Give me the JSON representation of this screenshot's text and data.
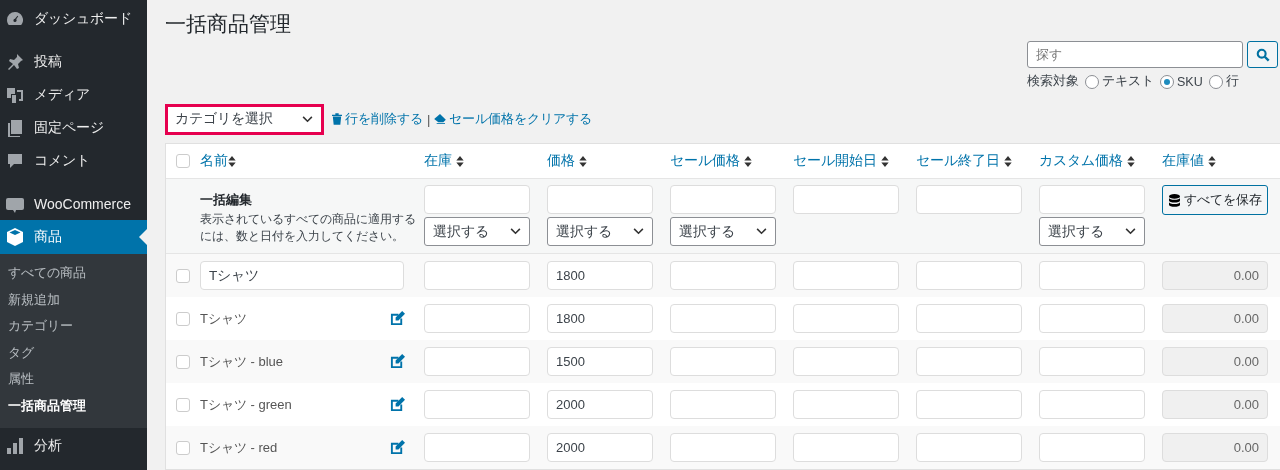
{
  "sidebar": {
    "groups": [
      [
        {
          "label": "ダッシュボード",
          "selected": false
        }
      ],
      [
        {
          "label": "投稿",
          "selected": false
        },
        {
          "label": "メディア",
          "selected": false
        },
        {
          "label": "固定ページ",
          "selected": false
        },
        {
          "label": "コメント",
          "selected": false
        }
      ],
      [
        {
          "label": "WooCommerce",
          "selected": false
        },
        {
          "label": "商品",
          "selected": true,
          "children": [
            {
              "label": "すべての商品",
              "selected": false
            },
            {
              "label": "新規追加",
              "selected": false
            },
            {
              "label": "カテゴリー",
              "selected": false
            },
            {
              "label": "タグ",
              "selected": false
            },
            {
              "label": "属性",
              "selected": false
            },
            {
              "label": "一括商品管理",
              "selected": true
            }
          ]
        },
        {
          "label": "分析",
          "selected": false
        }
      ]
    ]
  },
  "page_title": "一括商品管理",
  "search": {
    "placeholder": "探す",
    "target_label": "検索対象",
    "targets": [
      {
        "label": "テキスト",
        "selected": false
      },
      {
        "label": "SKU",
        "selected": true
      },
      {
        "label": "行",
        "selected": false
      }
    ]
  },
  "category_select": {
    "value": "カテゴリを選択"
  },
  "actions": [
    {
      "label": "行を削除する"
    },
    {
      "label": "セール価格をクリアする"
    }
  ],
  "action_separator": "|",
  "table": {
    "columns": [
      "名前",
      "在庫",
      "価格",
      "セール価格",
      "セール開始日",
      "セール終了日",
      "カスタム価格",
      "在庫値"
    ],
    "header_checked": false,
    "bulk": {
      "title": "一括編集",
      "description": "表示されているすべての商品に適用するには、数と日付を入力してください。",
      "fields": [
        {
          "kind": "input_select",
          "select": "選択する"
        },
        {
          "kind": "input_select",
          "select": "選択する"
        },
        {
          "kind": "input_select",
          "select": "選択する"
        },
        {
          "kind": "input"
        },
        {
          "kind": "input"
        },
        {
          "kind": "input_select",
          "select": "選択する"
        }
      ],
      "save_button": "すべてを保存"
    },
    "rows": [
      {
        "kind": "parent",
        "checked": false,
        "name": "Tシャツ",
        "price": "1800",
        "stock_value": "0.00"
      },
      {
        "kind": "variation",
        "checked": false,
        "name": "Tシャツ",
        "price": "1800",
        "stock_value": "0.00"
      },
      {
        "kind": "variation",
        "checked": false,
        "name": "Tシャツ - blue",
        "price": "1500",
        "stock_value": "0.00"
      },
      {
        "kind": "variation",
        "checked": false,
        "name": "Tシャツ - green",
        "price": "2000",
        "stock_value": "0.00"
      },
      {
        "kind": "variation",
        "checked": false,
        "name": "Tシャツ - red",
        "price": "2000",
        "stock_value": "0.00"
      }
    ]
  }
}
